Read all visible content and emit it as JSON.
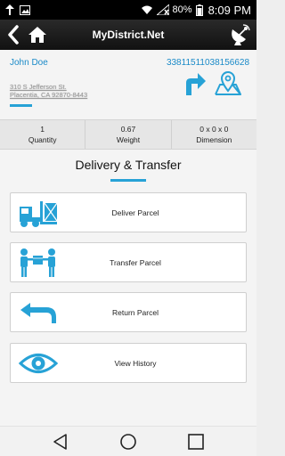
{
  "status_bar": {
    "battery": "80%",
    "time": "8:09 PM",
    "icons": [
      "notification-icon",
      "image-icon",
      "wifi-icon",
      "no-signal-icon",
      "battery-icon"
    ]
  },
  "action_bar": {
    "title": "MyDistrict.Net",
    "icons": [
      "back-icon",
      "home-icon",
      "satellite-dish-icon"
    ]
  },
  "customer": {
    "name": "John Doe",
    "tracking_number": "33811511038156628",
    "address_line1": "310 S Jefferson St.",
    "address_line2": "Placentia, CA 92870-8443"
  },
  "stats": [
    {
      "value": "1",
      "label": "Quantity"
    },
    {
      "value": "0.67",
      "label": "Weight"
    },
    {
      "value": "0 x 0 x 0",
      "label": "Dimension"
    }
  ],
  "section": {
    "title": "Delivery & Transfer"
  },
  "actions": [
    {
      "label": "Deliver Parcel",
      "icon": "forklift-icon"
    },
    {
      "label": "Transfer Parcel",
      "icon": "handoff-icon"
    },
    {
      "label": "Return Parcel",
      "icon": "return-arrow-icon"
    },
    {
      "label": "View History",
      "icon": "eye-icon"
    }
  ],
  "colors": {
    "accent": "#27a2d6",
    "link": "#1a8ac8"
  }
}
